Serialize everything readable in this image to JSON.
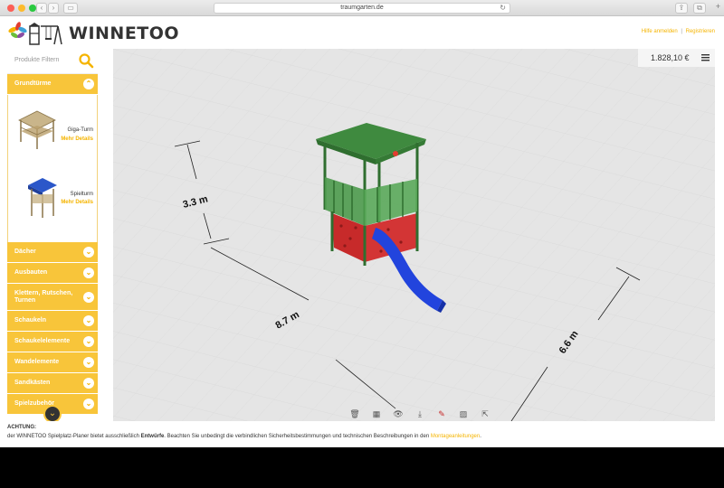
{
  "browser": {
    "url": "traumgarten.de"
  },
  "header": {
    "brand": "WINNETOO",
    "login": "Hilfe anmelden",
    "separator": "|",
    "register": "Registrieren"
  },
  "sidebar": {
    "filter_placeholder": "Produkte Filtern",
    "open_category": "Grundtürme",
    "products": [
      {
        "name": "Giga-Turm",
        "details": "Mehr Details"
      },
      {
        "name": "Spielturm",
        "details": "Mehr Details"
      }
    ],
    "categories": [
      "Dächer",
      "Ausbauten",
      "Klettern, Rutschen, Turnen",
      "Schaukeln",
      "Schaukelelemente",
      "Wandelemente",
      "Sandkästen",
      "Spielzubehör"
    ]
  },
  "viewport": {
    "price": "1.828,10 €",
    "dim_height": "3.3 m",
    "dim_width": "8.7 m",
    "dim_depth": "6.6 m",
    "toolbar": [
      "delete-icon",
      "grid-icon",
      "eye-icon",
      "download-icon",
      "brush-icon",
      "image-icon",
      "share-icon"
    ]
  },
  "footer": {
    "heading": "ACHTUNG:",
    "text_before": "der WINNETOO Spielplatz-Planer bietet ausschließlich ",
    "text_bold": "Entwürfe",
    "text_after": ". Beachten Sie unbedingt die verbindlichen Sicherheitsbestimmungen und technischen Beschreibungen in den ",
    "link": "Montageanleitungen",
    "end": "."
  },
  "colors": {
    "accent": "#f8c53a",
    "tower_green": "#3f8a3f",
    "wall_red": "#c72a2a",
    "slide_blue": "#2244dd"
  }
}
